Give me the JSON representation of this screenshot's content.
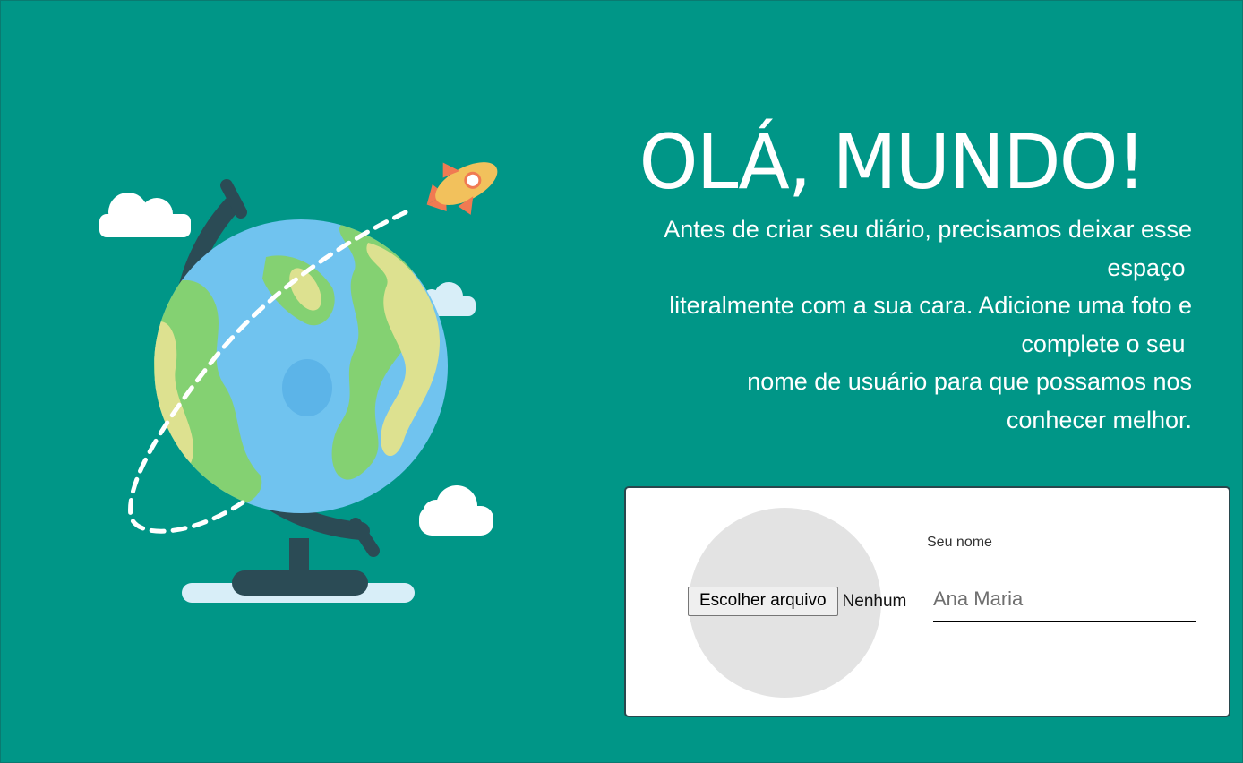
{
  "hero": {
    "title": "OLÁ, MUNDO!",
    "lines": [
      "Antes de criar seu diário, precisamos deixar esse",
      "espaço ",
      "literalmente com a sua cara. Adicione uma foto e",
      "complete o seu ",
      "nome de usuário para que possamos nos",
      "conhecer melhor."
    ]
  },
  "profile_form": {
    "file_button_label": "Escolher arquivo",
    "file_status": "Nenhum",
    "name_label": "Seu nome",
    "name_placeholder": "Ana Maria"
  },
  "colors": {
    "background": "#009687",
    "card_border": "#29474d",
    "avatar_placeholder": "#e3e3e3"
  },
  "icons": [
    "globe-illustration",
    "rocket-icon",
    "cloud-icon"
  ]
}
